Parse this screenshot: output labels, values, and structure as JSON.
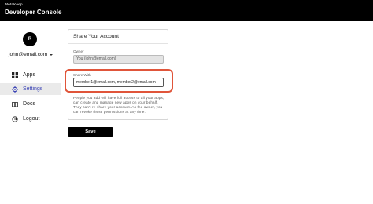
{
  "app": {
    "brand_small": "MetaKeep",
    "brand_title": "Developer Console"
  },
  "sidebar": {
    "avatar_initial": "R",
    "user_email": "john@email.com",
    "items": [
      {
        "label": "Apps",
        "icon": "grid-icon",
        "active": false
      },
      {
        "label": "Settings",
        "icon": "gear-icon",
        "active": true
      },
      {
        "label": "Docs",
        "icon": "book-icon",
        "active": false
      },
      {
        "label": "Logout",
        "icon": "logout-icon",
        "active": false
      }
    ]
  },
  "share_card": {
    "title": "Share Your Account",
    "owner_label": "Owner",
    "owner_value": "You (john@email.com)",
    "share_label": "Share With",
    "share_value": "member1@email.com, member2@email.com",
    "help_text": "People you add will have full access to all your apps, can create and manage new apps on your behalf. They can't re-share your account. As the owner, you can revoke these permissions at any time."
  },
  "actions": {
    "save_label": "Save"
  },
  "colors": {
    "topbar": "#000000",
    "active_nav_text": "#3a43b5",
    "highlight_border": "#e0553a"
  }
}
